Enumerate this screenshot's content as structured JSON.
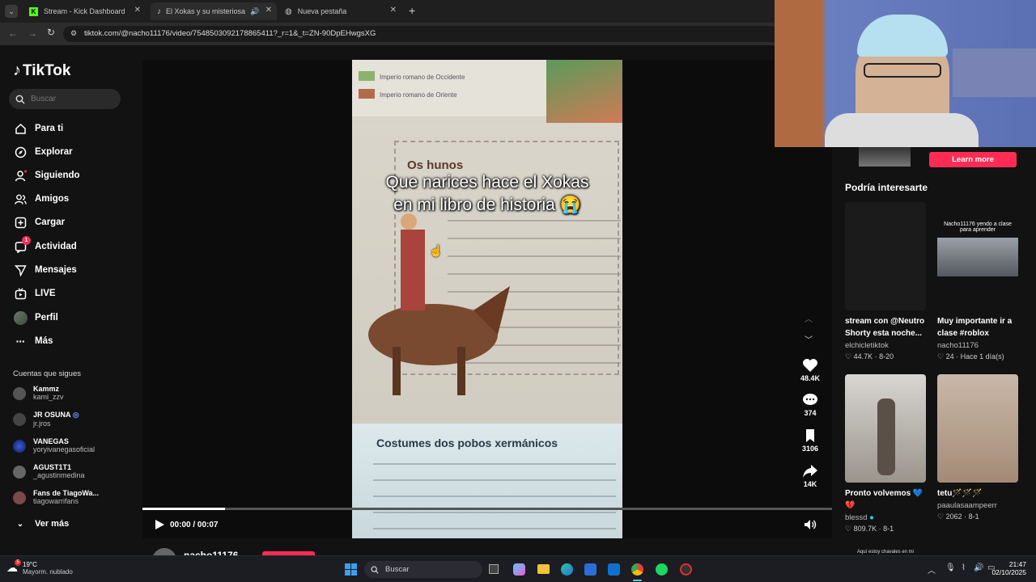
{
  "browser": {
    "tabs": [
      {
        "label": "Stream - Kick Dashboard"
      },
      {
        "label": "El Xokas y su misteriosa ap"
      },
      {
        "label": "Nueva pestaña"
      }
    ],
    "url": "tiktok.com/@nacho11176/video/7548503092178865411?_r=1&_t=ZN-90DpEHwgsXG"
  },
  "tiktok": {
    "logo": "TikTok",
    "search_placeholder": "Buscar",
    "nav": [
      {
        "label": "Para ti",
        "icon": "home-icon"
      },
      {
        "label": "Explorar",
        "icon": "compass-icon"
      },
      {
        "label": "Siguiendo",
        "icon": "person-icon"
      },
      {
        "label": "Amigos",
        "icon": "people-icon"
      },
      {
        "label": "Cargar",
        "icon": "upload-icon"
      },
      {
        "label": "Actividad",
        "icon": "inbox-icon",
        "badge": "1"
      },
      {
        "label": "Mensajes",
        "icon": "send-icon"
      },
      {
        "label": "LIVE",
        "icon": "live-icon"
      },
      {
        "label": "Perfil",
        "icon": "avatar-icon"
      },
      {
        "label": "Más",
        "icon": "more-icon"
      }
    ],
    "following_title": "Cuentas que sigues",
    "following": [
      {
        "name": "Kammz",
        "handle": "kami_zzv"
      },
      {
        "name": "JR OSUNA",
        "handle": "jr.jros"
      },
      {
        "name": "VANEGAS",
        "handle": "yoryivanegasoficial"
      },
      {
        "name": "AGUST1T1",
        "handle": "_agustinmedina"
      },
      {
        "name": "Fans de TiagoWa...",
        "handle": "tiagowarrifans"
      }
    ],
    "see_more": "Ver más",
    "video": {
      "caption_line1": "Que narices hace el Xokas",
      "caption_line2": "en mi libro de historia 😭",
      "legend1": "Imperio romano de Occidente",
      "legend2": "Imperio romano de Oriente",
      "heading1": "Os hunos",
      "heading2": "Costumes dos pobos xermánicos",
      "time": "00:00 / 00:07",
      "progress": 0.12,
      "author": "nacho11176"
    },
    "actions": [
      {
        "icon": "heart-icon",
        "count": "48.4K"
      },
      {
        "icon": "comment-icon",
        "count": "374"
      },
      {
        "icon": "bookmark-icon",
        "count": "3106"
      },
      {
        "icon": "share-icon",
        "count": "14K"
      }
    ],
    "learn_more": "Learn more",
    "recommend_title": "Podría interesarte",
    "recommend": [
      {
        "title": "stream con @Neutro Shorty esta noche...",
        "author": "elchicletiktok",
        "meta": "♡ 44.7K · 8-20",
        "overlay": ""
      },
      {
        "title": "Muy importante ir a clase #roblox",
        "author": "nacho11176",
        "meta": "♡ 24 · Hace 1 día(s)",
        "overlay": "Nacho11176 yendo a clase para aprender"
      },
      {
        "title": "Pronto volvemos 💙💔",
        "author": "blessd",
        "meta": "♡ 809.7K · 8-1",
        "overlay": ""
      },
      {
        "title": "tetu🪄🪄🪄",
        "author": "paaulasaampeerr",
        "meta": "♡ 2062 · 8-1",
        "overlay": ""
      }
    ],
    "next_overlay": "Aquí estoy chavales en mi"
  },
  "taskbar": {
    "temp": "19°C",
    "weather": "Mayorm. nublado",
    "search": "Buscar",
    "time": "21:47",
    "date": "02/10/2025"
  },
  "colors": {
    "accent": "#fe2c55",
    "bg": "#121212"
  }
}
